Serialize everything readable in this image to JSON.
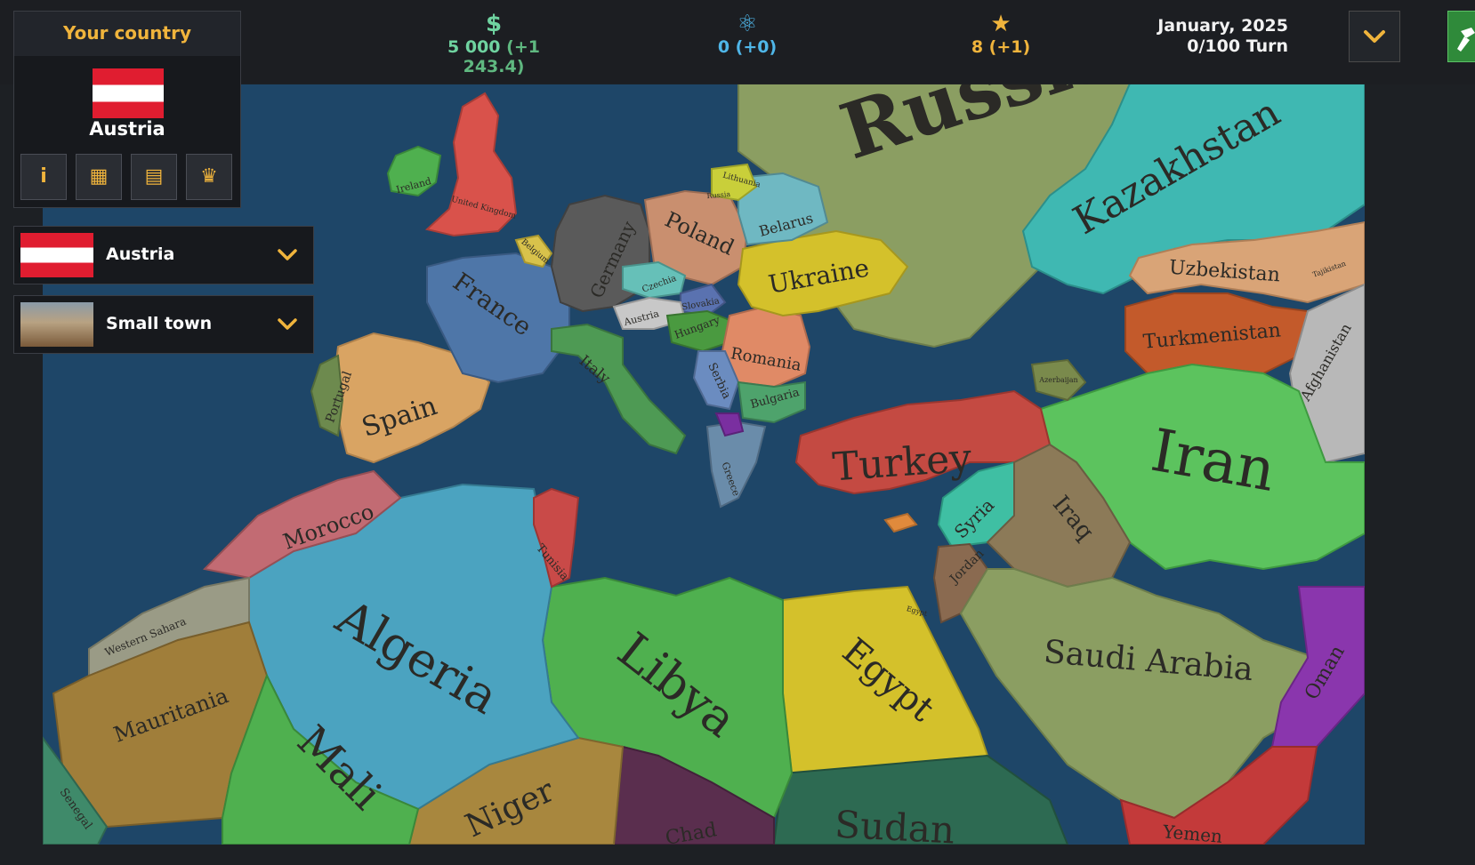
{
  "top_stats": {
    "money": {
      "icon": "dollar-icon",
      "value": "5 000",
      "delta": "(+1 243.4)",
      "color": "#6fd3a0"
    },
    "science": {
      "icon": "atom-icon",
      "value": "0",
      "delta": "(+0)",
      "color": "#4fb6e8"
    },
    "prestige": {
      "icon": "star-icon",
      "value": "8",
      "delta": "(+1)",
      "color": "#f0b43c"
    },
    "date": "January, 2025",
    "turn": "0/100 Turn"
  },
  "country_panel": {
    "header": "Your country",
    "name": "Austria",
    "buttons": [
      {
        "name": "info-button",
        "icon": "info-icon",
        "glyph": "i"
      },
      {
        "name": "network-button",
        "icon": "network-icon",
        "glyph": "▦"
      },
      {
        "name": "document-button",
        "icon": "document-check-icon",
        "glyph": "▤"
      },
      {
        "name": "trophy-button",
        "icon": "trophy-icon",
        "glyph": "♛"
      }
    ]
  },
  "selectors": {
    "country": {
      "label": "Austria"
    },
    "scenario": {
      "label": "Small town"
    }
  },
  "map": {
    "labels": {
      "russia": "Russia",
      "kazakhstan": "Kazakhstan",
      "uzbekistan": "Uzbekistan",
      "turkmenistan": "Turkmenistan",
      "afghanistan": "Afghanistan",
      "iran": "Iran",
      "iraq": "Iraq",
      "syria": "Syria",
      "jordan": "Jordan",
      "saudi": "Saudi Arabia",
      "oman": "Oman",
      "yemen": "Yemen",
      "turkey": "Turkey",
      "egypt": "Egypt",
      "sudan": "Sudan",
      "libya": "Libya",
      "chad": "Chad",
      "niger": "Niger",
      "mali": "Mali",
      "algeria": "Algeria",
      "tunisia": "Tunisia",
      "morocco": "Morocco",
      "western_sahara": "Western Sahara",
      "mauritania": "Mauritania",
      "senegal": "Senegal",
      "spain": "Spain",
      "portugal": "Portugal",
      "france": "France",
      "italy": "Italy",
      "germany": "Germany",
      "poland": "Poland",
      "ukraine": "Ukraine",
      "belarus": "Belarus",
      "romania": "Romania",
      "bulgaria": "Bulgaria",
      "serbia": "Serbia",
      "greece": "Greece",
      "hungary": "Hungary",
      "austria": "Austria",
      "slovakia": "Slovakia",
      "czechia": "Czechia",
      "belgium": "Belgium",
      "united_kingdom": "United Kingdom",
      "ireland": "Ireland",
      "lithuania": "Lithuania",
      "russia_small": "Russia",
      "azerbaijan": "Azerbaijan",
      "egypt_small": "Egypt",
      "tajikistan": "Tajikistan"
    }
  }
}
